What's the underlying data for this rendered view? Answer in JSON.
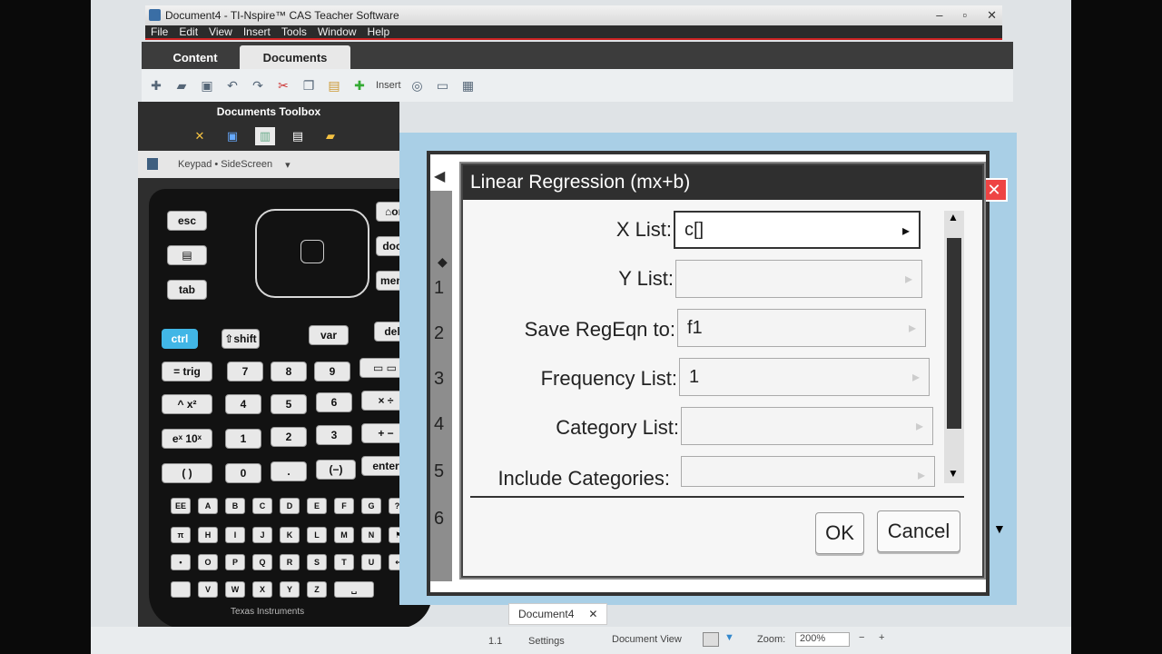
{
  "window": {
    "title": "Document4 - TI-Nspire™ CAS Teacher Software"
  },
  "menu": [
    "File",
    "Edit",
    "View",
    "Insert",
    "Tools",
    "Window",
    "Help"
  ],
  "tabs": {
    "content": "Content",
    "documents": "Documents"
  },
  "toolbar": {
    "insert_label": "Insert"
  },
  "toolbox": {
    "title": "Documents Toolbox",
    "keypad_select": "Keypad • SideScreen"
  },
  "calculator": {
    "keys": {
      "esc": "esc",
      "home": "⌂on",
      "doc": "doc▸",
      "menu": "menu",
      "tab": "tab",
      "ctrl": "ctrl",
      "shift": "⇧shift",
      "var": "var",
      "del": "del",
      "trig": "= trig",
      "k7": "7",
      "k8": "8",
      "k9": "9",
      "power": "^  x²",
      "k4": "4",
      "k5": "5",
      "k6": "6",
      "times": "×  ÷",
      "ex": "eˣ 10ˣ",
      "k1": "1",
      "k2": "2",
      "k3": "3",
      "plus": "+  −",
      "paren": "(   )",
      "k0": "0",
      "dot": ".",
      "neg": "(−)",
      "enter": "enter"
    },
    "letters": [
      "A",
      "B",
      "C",
      "D",
      "E",
      "F",
      "G",
      "H",
      "I",
      "J",
      "K",
      "L",
      "M",
      "N",
      "O",
      "P",
      "Q",
      "R",
      "S",
      "T",
      "U",
      "V",
      "W",
      "X",
      "Y",
      "Z"
    ],
    "brand": "Texas Instruments"
  },
  "dialog": {
    "title": "Linear Regression (mx+b)",
    "fields": [
      {
        "label": "X List:",
        "value": "c[]"
      },
      {
        "label": "Y List:",
        "value": ""
      },
      {
        "label": "Save RegEqn to:",
        "value": "f1"
      },
      {
        "label": "Frequency List:",
        "value": "1"
      },
      {
        "label": "Category List:",
        "value": ""
      },
      {
        "label": "Include Categories:",
        "value": ""
      }
    ],
    "ok": "OK",
    "cancel": "Cancel"
  },
  "spreadsheet": {
    "rows": [
      "1",
      "2",
      "3",
      "4",
      "5",
      "6"
    ]
  },
  "doc_tabs": {
    "current": "Document4"
  },
  "status": {
    "position": "1.1",
    "settings": "Settings",
    "view_label": "Document View",
    "zoom_label": "Zoom:",
    "zoom_value": "200%"
  }
}
